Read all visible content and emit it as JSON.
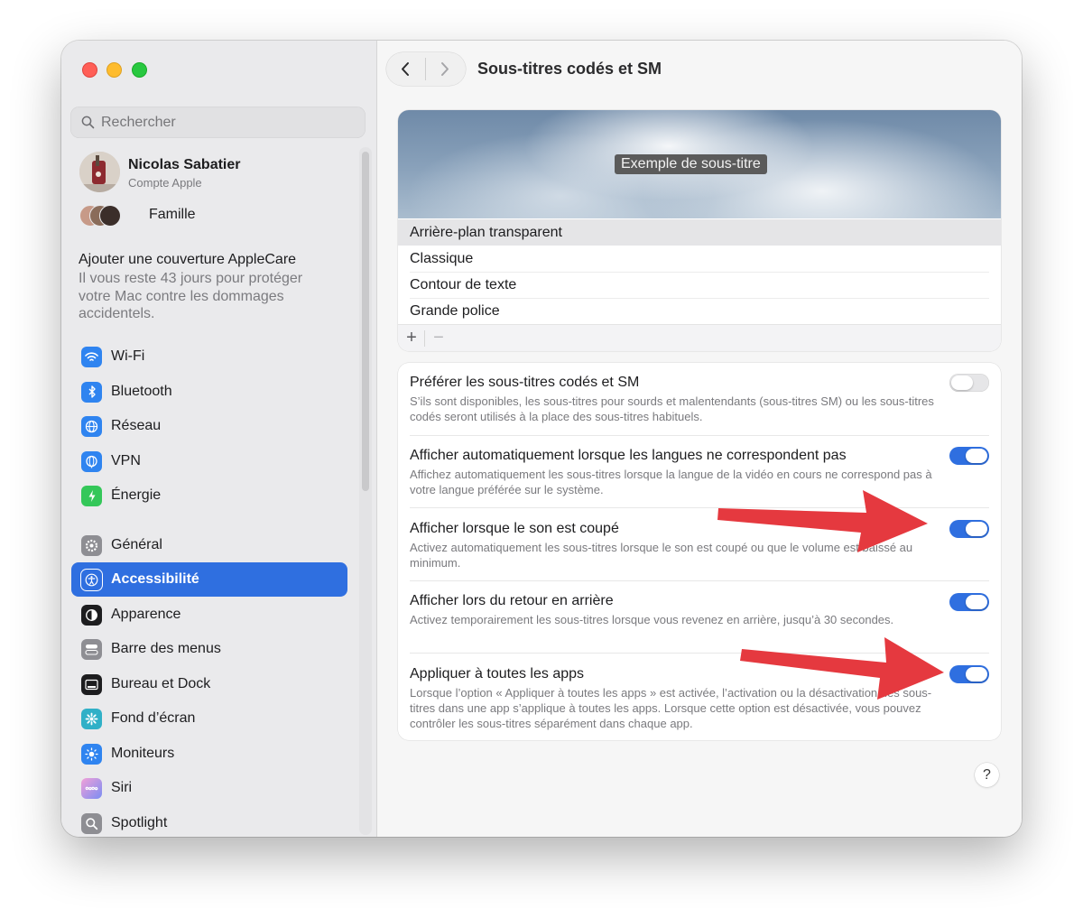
{
  "search": {
    "placeholder": "Rechercher"
  },
  "account": {
    "name": "Nicolas Sabatier",
    "subtitle": "Compte Apple"
  },
  "family": {
    "label": "Famille"
  },
  "applecare": {
    "title": "Ajouter une couverture AppleCare",
    "body": "Il vous reste 43 jours pour protéger votre Mac contre les dommages accidentels."
  },
  "sidebar": {
    "items": [
      {
        "label": "Wi-Fi",
        "icon": "wifi-icon",
        "color": "#2f84f0"
      },
      {
        "label": "Bluetooth",
        "icon": "bluetooth-icon",
        "color": "#2f84f0"
      },
      {
        "label": "Réseau",
        "icon": "globe-icon",
        "color": "#2f84f0"
      },
      {
        "label": "VPN",
        "icon": "vpn-globe-icon",
        "color": "#2f84f0"
      },
      {
        "label": "Énergie",
        "icon": "battery-bolt-icon",
        "color": "#34c759"
      },
      {
        "label": "Général",
        "icon": "gear-icon",
        "color": "#8e8e93"
      },
      {
        "label": "Accessibilité",
        "icon": "accessibility-icon",
        "color": "#2f6fe0",
        "selected": true
      },
      {
        "label": "Apparence",
        "icon": "appearance-icon",
        "color": "#1d1d1f"
      },
      {
        "label": "Barre des menus",
        "icon": "menubar-icon",
        "color": "#8e8e93"
      },
      {
        "label": "Bureau et Dock",
        "icon": "dock-icon",
        "color": "#1d1d1f"
      },
      {
        "label": "Fond d’écran",
        "icon": "wallpaper-icon",
        "color": "#30b0c7"
      },
      {
        "label": "Moniteurs",
        "icon": "brightness-icon",
        "color": "#2f84f0"
      },
      {
        "label": "Siri",
        "icon": "siri-icon",
        "color": "#e05ad1"
      },
      {
        "label": "Spotlight",
        "icon": "magnifier-icon",
        "color": "#8e8e93"
      }
    ]
  },
  "header": {
    "title": "Sous-titres codés et SM",
    "back": "‹",
    "forward": "›"
  },
  "preview": {
    "sample_text": "Exemple de sous-titre"
  },
  "styles": {
    "items": [
      {
        "label": "Arrière-plan transparent",
        "selected": true
      },
      {
        "label": "Classique"
      },
      {
        "label": "Contour de texte"
      },
      {
        "label": "Grande police"
      }
    ],
    "add_label": "+",
    "remove_label": "−"
  },
  "options": [
    {
      "title": "Préférer les sous-titres codés et SM",
      "description": "S’ils sont disponibles, les sous-titres pour sourds et malentendants (sous-titres SM) ou les sous-titres codés seront utilisés à la place des sous-titres habituels.",
      "enabled": false
    },
    {
      "title": "Afficher automatiquement lorsque les langues ne correspondent pas",
      "description": "Affichez automatiquement les sous-titres lorsque la langue de la vidéo en cours ne correspond pas à votre langue préférée sur le système.",
      "enabled": true
    },
    {
      "title": "Afficher lorsque le son est coupé",
      "description": "Activez automatiquement les sous-titres lorsque le son est coupé ou que le volume est baissé au minimum.",
      "enabled": true
    },
    {
      "title": "Afficher lors du retour en arrière",
      "description": "Activez temporairement les sous-titres lorsque vous revenez en arrière, jusqu’à 30 secondes.",
      "enabled": true
    },
    {
      "title": "Appliquer à toutes les apps",
      "description": "Lorsque l’option « Appliquer à toutes les apps » est activée, l’activation ou la désactivation des sous-titres dans une app s’applique à toutes les apps. Lorsque cette option est désactivée, vous pouvez contrôler les sous-titres séparément dans chaque app.",
      "enabled": true
    }
  ],
  "help": {
    "label": "?"
  },
  "colors": {
    "accent": "#2f6fe0",
    "annotation_arrow": "#e5393f"
  }
}
